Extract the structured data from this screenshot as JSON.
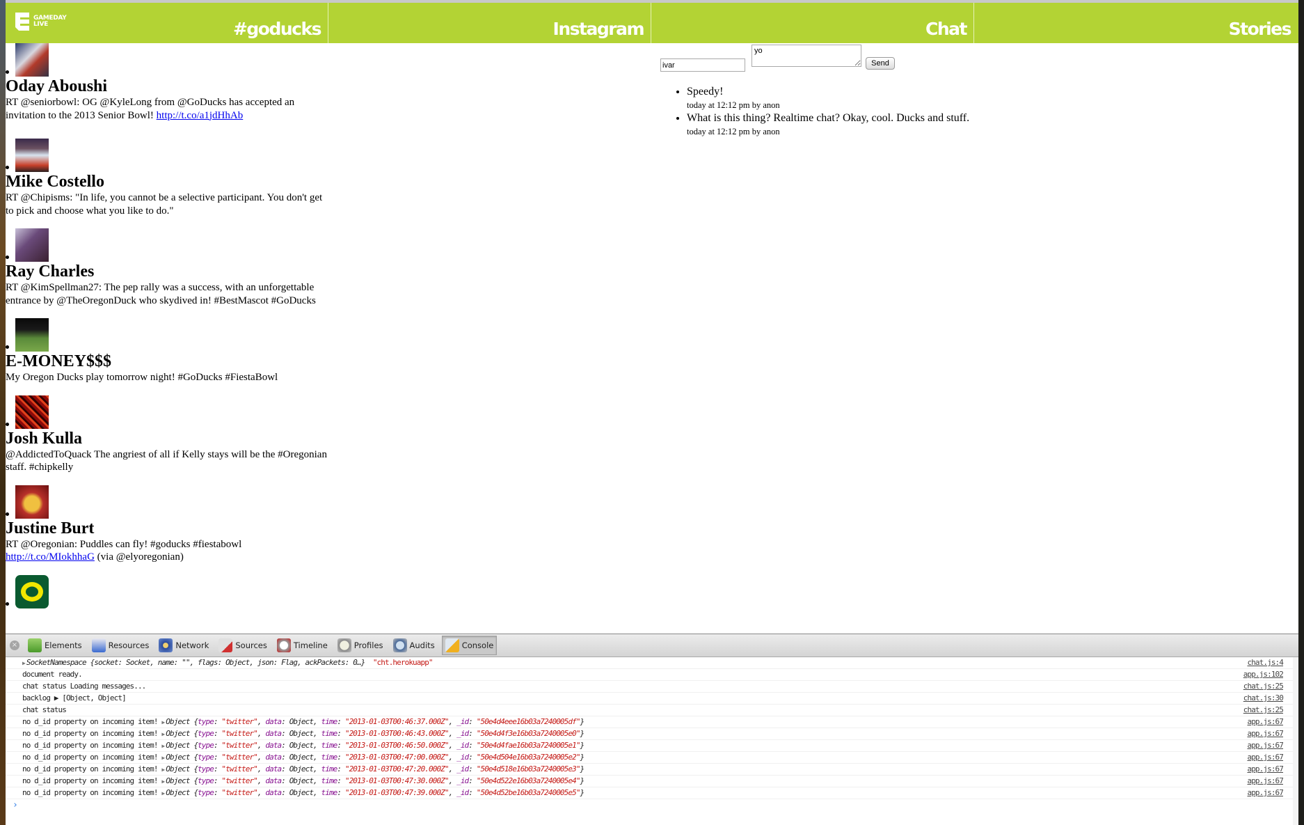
{
  "header": {
    "brand_line1": "GAMEDAY",
    "brand_line2": "LIVE",
    "columns": [
      {
        "label": "#goducks"
      },
      {
        "label": "Instagram"
      },
      {
        "label": "Chat"
      },
      {
        "label": "Stories"
      }
    ],
    "accent_color": "#b3d334"
  },
  "feed": {
    "items": [
      {
        "name": "Oday Aboushi",
        "text": "RT @seniorbowl: OG @KyleLong from @GoDucks has accepted an invitation to the 2013 Senior Bowl! ",
        "link": "http://t.co/a1jdHhAb",
        "after_link": "",
        "avatar": "football-players-avatar"
      },
      {
        "name": "Mike Costello",
        "text": "RT @Chipisms: \"In life, you cannot be a selective participant. You don't get to pick and choose what you like to do.\"",
        "link": "",
        "after_link": "",
        "avatar": "couple-photo-avatar"
      },
      {
        "name": "Ray Charles",
        "text": "RT @KimSpellman27: The pep rally was a success, with an unforgettable entrance by @TheOregonDuck who skydived in! #BestMascot #GoDucks",
        "link": "",
        "after_link": "",
        "avatar": "purple-photo-avatar"
      },
      {
        "name": "E-MONEY$$$",
        "text": "My Oregon Ducks play tomorrow night! #GoDucks #FiestaBowl",
        "link": "",
        "after_link": "",
        "avatar": "soccer-field-avatar"
      },
      {
        "name": "Josh Kulla",
        "text": "@AddictedToQuack The angriest of all if Kelly stays will be the #Oregonian staff. #chipkelly",
        "link": "",
        "after_link": "",
        "avatar": "red-pattern-avatar"
      },
      {
        "name": "Justine Burt",
        "text": "RT @Oregonian: Puddles can fly! #goducks #fiestabowl ",
        "link": "http://t.co/MIokhhaG",
        "after_link": " (via @elyoregonian)",
        "avatar": "gold-crest-avatar"
      },
      {
        "name": "",
        "text": "",
        "link": "",
        "after_link": "",
        "avatar": "oregon-o-logo-avatar"
      }
    ]
  },
  "chat": {
    "name_value": "ivar",
    "message_value": "yo",
    "send_label": "Send",
    "messages": [
      {
        "text": "Speedy!",
        "meta": "today at 12:12 pm by anon"
      },
      {
        "text": "What is this thing? Realtime chat? Okay, cool. Ducks and stuff.",
        "meta": "today at 12:12 pm by anon"
      }
    ]
  },
  "devtools": {
    "tabs": [
      {
        "label": "Elements",
        "icon": "elements-icon",
        "active": false
      },
      {
        "label": "Resources",
        "icon": "resources-icon",
        "active": false
      },
      {
        "label": "Network",
        "icon": "network-icon",
        "active": false
      },
      {
        "label": "Sources",
        "icon": "sources-icon",
        "active": false
      },
      {
        "label": "Timeline",
        "icon": "timeline-icon",
        "active": false
      },
      {
        "label": "Profiles",
        "icon": "profiles-icon",
        "active": false
      },
      {
        "label": "Audits",
        "icon": "audits-icon",
        "active": false
      },
      {
        "label": "Console",
        "icon": "console-icon",
        "active": true
      }
    ],
    "console": {
      "socket_line": {
        "prefix": "SocketNamespace",
        "body": "{socket: Socket, name: \"\", flags: Object, json: Flag, ackPackets: 0…}",
        "string": "\"cht.herokuapp\"",
        "source": "chat.js:4"
      },
      "simple_lines": [
        {
          "text": "document ready.",
          "source": "app.js:102"
        },
        {
          "text": "chat status Loading messages...",
          "source": "chat.js:25"
        },
        {
          "text": "backlog ▶ [Object, Object]",
          "source": "chat.js:30"
        },
        {
          "text": "chat status",
          "source": "chat.js:25"
        }
      ],
      "item_lines": [
        {
          "message": "no d_id property on incoming item!",
          "type": "twitter",
          "time": "2013-01-03T00:46:37.000Z",
          "id": "50e4d4eee16b03a7240005df",
          "source": "app.js:67"
        },
        {
          "message": "no d_id property on incoming item!",
          "type": "twitter",
          "time": "2013-01-03T00:46:43.000Z",
          "id": "50e4d4f3e16b03a7240005e0",
          "source": "app.js:67"
        },
        {
          "message": "no d_id property on incoming item!",
          "type": "twitter",
          "time": "2013-01-03T00:46:50.000Z",
          "id": "50e4d4fae16b03a7240005e1",
          "source": "app.js:67"
        },
        {
          "message": "no d_id property on incoming item!",
          "type": "twitter",
          "time": "2013-01-03T00:47:00.000Z",
          "id": "50e4d504e16b03a7240005e2",
          "source": "app.js:67"
        },
        {
          "message": "no d_id property on incoming item!",
          "type": "twitter",
          "time": "2013-01-03T00:47:20.000Z",
          "id": "50e4d518e16b03a7240005e3",
          "source": "app.js:67"
        },
        {
          "message": "no d_id property on incoming item!",
          "type": "twitter",
          "time": "2013-01-03T00:47:30.000Z",
          "id": "50e4d522e16b03a7240005e4",
          "source": "app.js:67"
        },
        {
          "message": "no d_id property on incoming item!",
          "type": "twitter",
          "time": "2013-01-03T00:47:39.000Z",
          "id": "50e4d52be16b03a7240005e5",
          "source": "app.js:67"
        }
      ],
      "prompt": "›"
    }
  }
}
